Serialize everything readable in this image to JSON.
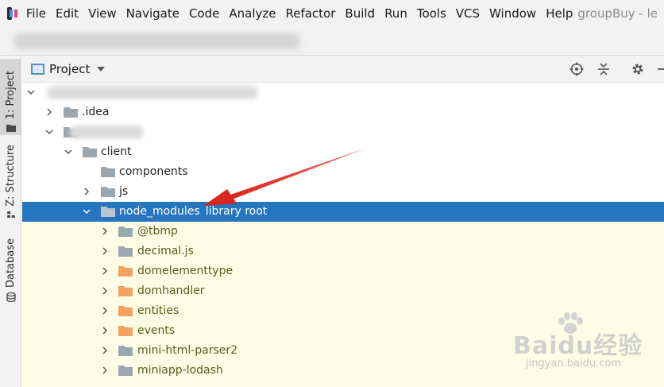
{
  "menubar": {
    "items": [
      "File",
      "Edit",
      "View",
      "Navigate",
      "Code",
      "Analyze",
      "Refactor",
      "Build",
      "Run",
      "Tools",
      "VCS",
      "Window",
      "Help"
    ],
    "window_title": "groupBuy - le"
  },
  "tool_strip": {
    "tabs": [
      "1: Project",
      "Z: Structure",
      "Database"
    ]
  },
  "panel": {
    "title": "Project",
    "icons": [
      "locate-icon",
      "collapse-all-icon",
      "gear-icon",
      "minimize-icon"
    ]
  },
  "tree": {
    "rows": [
      {
        "label": "",
        "blurred": true
      },
      {
        "label": ".idea"
      },
      {
        "label": "",
        "blurred": true
      },
      {
        "label": "client"
      },
      {
        "label": "components"
      },
      {
        "label": "js"
      },
      {
        "label": "node_modules",
        "extra": "library root"
      },
      {
        "label": "@tbmp"
      },
      {
        "label": "decimal.js"
      },
      {
        "label": "domelementtype"
      },
      {
        "label": "domhandler"
      },
      {
        "label": "entities"
      },
      {
        "label": "events"
      },
      {
        "label": "mini-html-parser2"
      },
      {
        "label": "miniapp-lodash"
      }
    ]
  },
  "colors": {
    "selection": "#2675bf",
    "library_bg": "#fdfde6",
    "folder_grey": "#9aa7b0",
    "folder_orange": "#f4a261",
    "arrow": "#e0332b"
  },
  "watermark": {
    "main": "Baidu经验",
    "sub": "jingyan.baidu.com"
  }
}
